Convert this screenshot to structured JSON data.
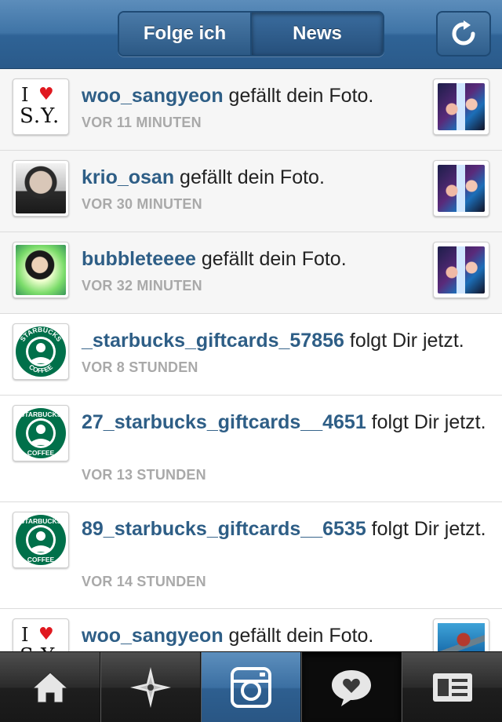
{
  "header": {
    "tab_following": "Folge ich",
    "tab_news": "News",
    "active_tab": "News",
    "refresh_icon": "refresh-icon"
  },
  "feed": {
    "items": [
      {
        "username": "woo_sangyeon",
        "action": " gefällt dein Foto.",
        "time": "VOR 11 MINUTEN",
        "avatar": "i-love-sy-logo",
        "thumbnail": "liked-photo"
      },
      {
        "username": "krio_osan",
        "action": " gefällt dein Foto.",
        "time": "VOR 30 MINUTEN",
        "avatar": "user-photo",
        "thumbnail": "liked-photo"
      },
      {
        "username": "bubbleteeee",
        "action": " gefällt dein Foto.",
        "time": "VOR 32 MINUTEN",
        "avatar": "user-photo",
        "thumbnail": "liked-photo"
      },
      {
        "username": "_starbucks_giftcards_57856",
        "action": " folgt Dir jetzt.",
        "time": "VOR 8 STUNDEN",
        "avatar": "starbucks-logo"
      },
      {
        "username": "27_starbucks_giftcards__4651",
        "action": " folgt Dir jetzt.",
        "time": "VOR 13 STUNDEN",
        "avatar": "starbucks-logo"
      },
      {
        "username": "89_starbucks_giftcards__6535",
        "action": " folgt Dir jetzt.",
        "time": "VOR 14 STUNDEN",
        "avatar": "starbucks-logo"
      },
      {
        "username": "woo_sangyeon",
        "action": " gefällt dein Foto.",
        "time": "",
        "avatar": "i-love-sy-logo",
        "thumbnail": "liked-photo"
      }
    ],
    "sy_logo": {
      "i": "I",
      "heart": "♥",
      "sy": "S.Y."
    },
    "starbucks_logo": {
      "top": "STARBUCKS",
      "bottom": "COFFEE"
    }
  },
  "tabbar": {
    "tabs": [
      {
        "icon": "home-icon"
      },
      {
        "icon": "explore-icon"
      },
      {
        "icon": "camera-icon"
      },
      {
        "icon": "news-heart-icon",
        "active": true
      },
      {
        "icon": "profile-icon"
      }
    ]
  },
  "colors": {
    "navbar": "#3f74a6",
    "username": "#2e5e86",
    "timestamp": "#a9a9a9",
    "camera_tab": "#3b6fa2",
    "heart": "#e0181f",
    "starbucks_green": "#00704a"
  }
}
